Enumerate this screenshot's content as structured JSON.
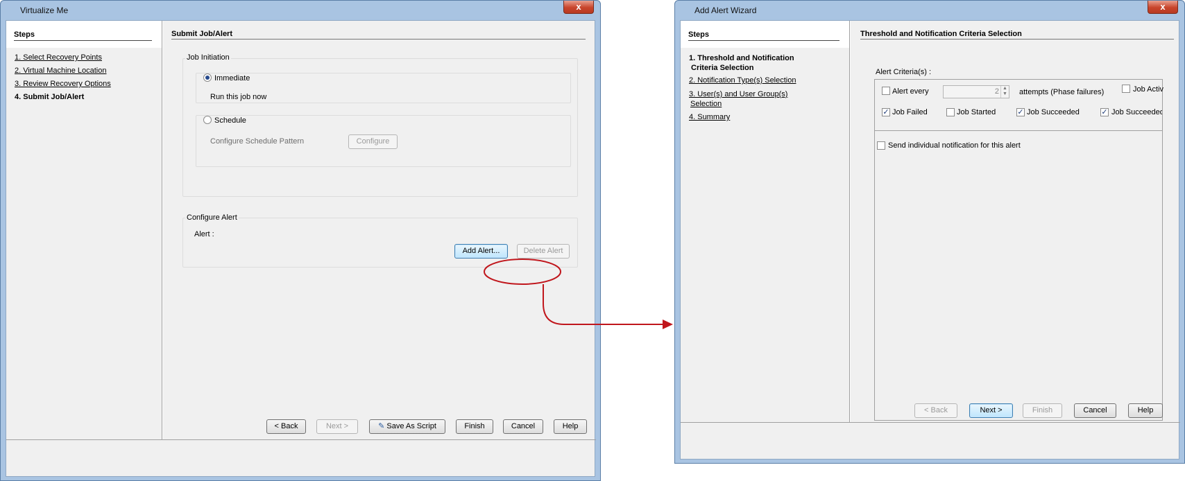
{
  "left_window": {
    "title": "Virtualize Me",
    "close_label": "x",
    "steps_heading": "Steps",
    "steps": [
      {
        "label": "1. Select Recovery Points"
      },
      {
        "label": "2. Virtual Machine Location"
      },
      {
        "label": "3. Review Recovery Options"
      },
      {
        "label": "4. Submit Job/Alert"
      }
    ],
    "page_title": "Submit Job/Alert",
    "job_initiation": {
      "group_label": "Job Initiation",
      "immediate_label": "Immediate",
      "immediate_selected": true,
      "immediate_desc": "Run this job now",
      "schedule_label": "Schedule",
      "schedule_selected": false,
      "schedule_desc": "Configure Schedule Pattern",
      "configure_button": "Configure"
    },
    "configure_alert": {
      "group_label": "Configure Alert",
      "alert_label": "Alert :",
      "add_button": "Add Alert...",
      "delete_button": "Delete Alert"
    },
    "footer": {
      "back": "< Back",
      "next": "Next >",
      "save_script": "Save As Script",
      "finish": "Finish",
      "cancel": "Cancel",
      "help": "Help"
    }
  },
  "right_window": {
    "title": "Add Alert Wizard",
    "close_label": "x",
    "steps_heading": "Steps",
    "steps": [
      {
        "label_line1": "1. Threshold and Notification",
        "label_line2": "Criteria Selection"
      },
      {
        "label": "2. Notification Type(s) Selection"
      },
      {
        "label_line1": "3. User(s) and User Group(s)",
        "label_line2": "Selection"
      },
      {
        "label": "4. Summary"
      }
    ],
    "page_title": "Threshold and Notification Criteria Selection",
    "criteria": {
      "label": "Alert Criteria(s) :",
      "alert_every_label": "Alert every",
      "alert_every_checked": false,
      "attempts_value": "2",
      "attempts_label": "attempts (Phase failures)",
      "job_activity_label": "Job Activ",
      "job_failed_label": "Job Failed",
      "job_failed_checked": true,
      "job_started_label": "Job Started",
      "job_started_checked": false,
      "job_succeeded_label": "Job Succeeded",
      "job_succeeded_checked": true,
      "job_succeeded_w_label": "Job Succeeded v",
      "job_succeeded_w_checked": true,
      "individual_label": "Send individual notification for this alert",
      "individual_checked": false
    },
    "footer": {
      "back": "< Back",
      "next": "Next >",
      "finish": "Finish",
      "cancel": "Cancel",
      "help": "Help"
    }
  },
  "colors": {
    "highlight_red": "#c0161c",
    "window_frame": "#a9c4e2"
  }
}
